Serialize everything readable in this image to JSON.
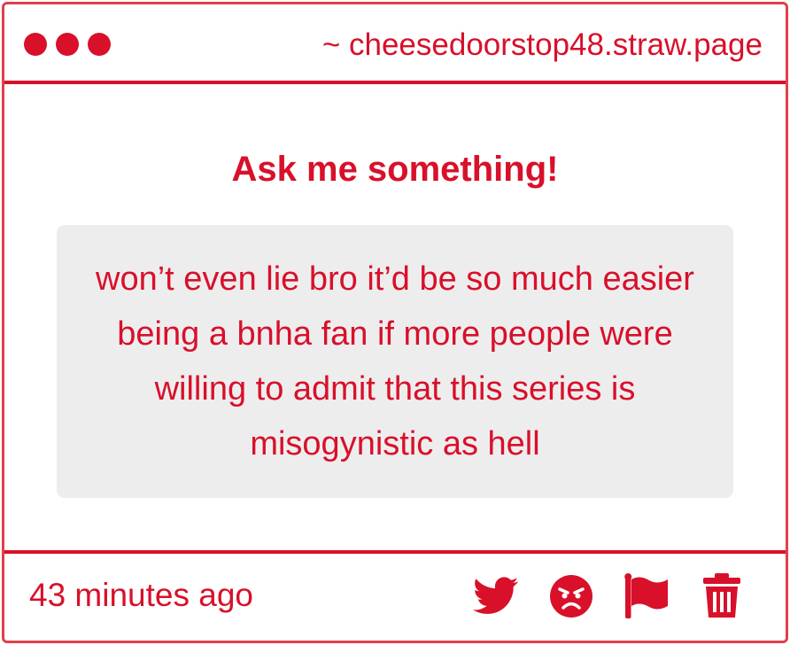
{
  "window": {
    "url": "~ cheesedoorstop48.straw.page"
  },
  "main": {
    "heading": "Ask me something!",
    "question": "won’t even lie bro it’d be so much easier being a bnha fan if more people were willing to admit that this series is misogynistic as hell"
  },
  "footer": {
    "timestamp": "43 minutes ago",
    "actions": [
      {
        "icon": "twitter-icon"
      },
      {
        "icon": "angry-face-icon"
      },
      {
        "icon": "flag-icon"
      },
      {
        "icon": "trash-icon"
      }
    ]
  },
  "colors": {
    "accent": "#d8102a",
    "border": "#e0404c",
    "box_background": "#eeedee",
    "background": "#ffffff"
  }
}
